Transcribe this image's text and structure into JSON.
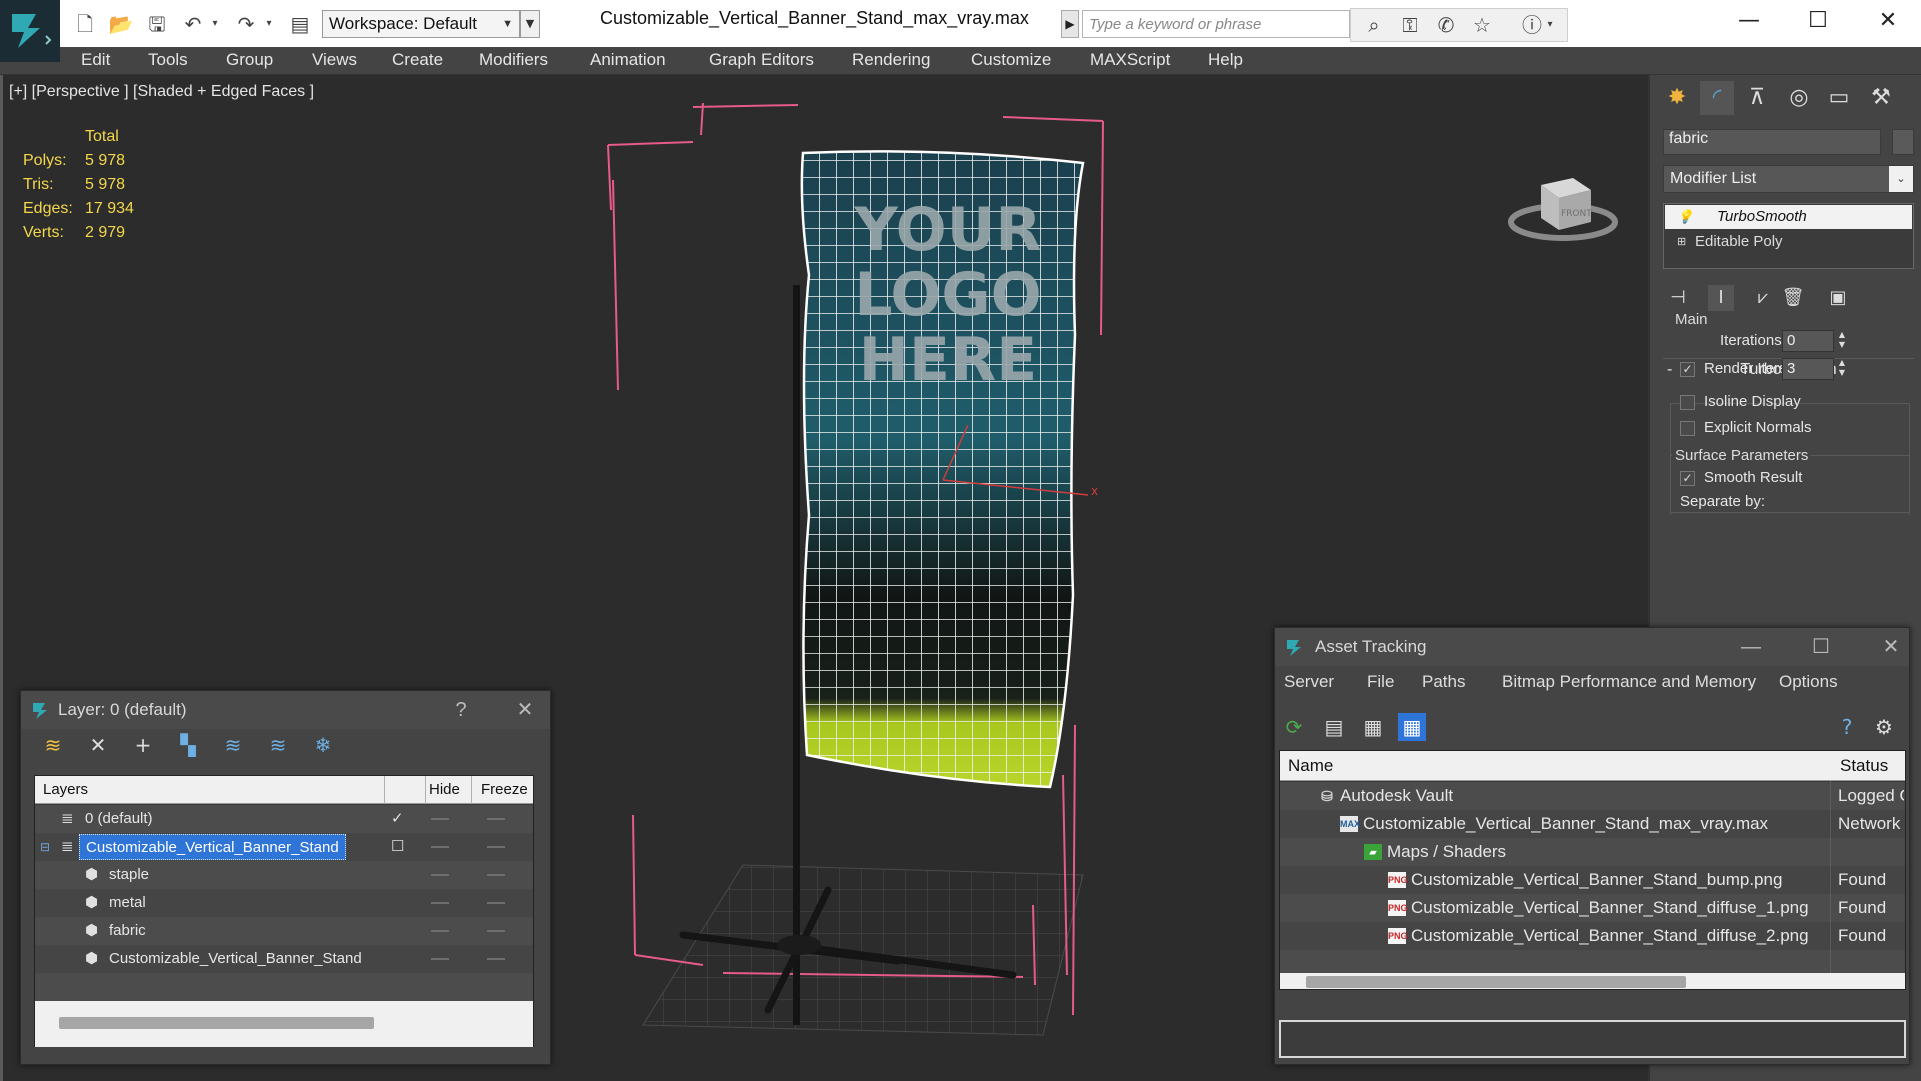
{
  "window": {
    "title": "Customizable_Vertical_Banner_Stand_max_vray.max",
    "workspace": "Workspace: Default",
    "search_placeholder": "Type a keyword or phrase",
    "minimize": "—",
    "maximize": "☐",
    "close": "✕"
  },
  "menu": [
    "Edit",
    "Tools",
    "Group",
    "Views",
    "Create",
    "Modifiers",
    "Animation",
    "Graph Editors",
    "Rendering",
    "Customize",
    "MAXScript",
    "Help"
  ],
  "viewport": {
    "label": "[+] [Perspective ] [Shaded + Edged Faces ]",
    "banner_text": [
      "YOUR",
      "LOGO",
      "HERE"
    ],
    "viewcube_label": "FRONT",
    "stats": {
      "header": "Total",
      "rows": [
        {
          "label": "Polys:",
          "value": "5 978"
        },
        {
          "label": "Tris:",
          "value": "5 978"
        },
        {
          "label": "Edges:",
          "value": "17 934"
        },
        {
          "label": "Verts:",
          "value": "2 979"
        }
      ]
    }
  },
  "command_panel": {
    "object_name": "fabric",
    "modifier_list": "Modifier List",
    "stack": [
      "TurboSmooth",
      "Editable Poly"
    ],
    "rollout": {
      "title": "TurboSmooth",
      "main_group": "Main",
      "iterations_label": "Iterations:",
      "iterations_value": "0",
      "render_iters_label": "Render Iters:",
      "render_iters_value": "3",
      "render_iters_checked": true,
      "isoline_label": "Isoline Display",
      "explicit_label": "Explicit Normals",
      "surface_group": "Surface Parameters",
      "smooth_result_label": "Smooth Result",
      "smooth_result_checked": true,
      "separate_by_label": "Separate by:"
    }
  },
  "layer_dialog": {
    "title": "Layer: 0 (default)",
    "help": "?",
    "columns": [
      "Layers",
      "Hide",
      "Freeze"
    ],
    "rows": [
      {
        "name": "0 (default)",
        "indent": 0,
        "active": true
      },
      {
        "name": "Customizable_Vertical_Banner_Stand",
        "indent": 0,
        "selected": true
      },
      {
        "name": "staple",
        "indent": 1
      },
      {
        "name": "metal",
        "indent": 1
      },
      {
        "name": "fabric",
        "indent": 1
      },
      {
        "name": "Customizable_Vertical_Banner_Stand",
        "indent": 1
      }
    ]
  },
  "asset_dialog": {
    "title": "Asset Tracking",
    "menu": [
      "Server",
      "File",
      "Paths",
      "Bitmap Performance and Memory",
      "Options"
    ],
    "columns": [
      "Name",
      "Status"
    ],
    "rows": [
      {
        "name": "Autodesk Vault",
        "status": "Logged Out",
        "indent": 0,
        "icon": "vault"
      },
      {
        "name": "Customizable_Vertical_Banner_Stand_max_vray.max",
        "status": "Network",
        "indent": 1,
        "icon": "max"
      },
      {
        "name": "Maps / Shaders",
        "status": "",
        "indent": 2,
        "icon": "maps"
      },
      {
        "name": "Customizable_Vertical_Banner_Stand_bump.png",
        "status": "Found",
        "indent": 3,
        "icon": "png"
      },
      {
        "name": "Customizable_Vertical_Banner_Stand_diffuse_1.png",
        "status": "Found",
        "indent": 3,
        "icon": "png"
      },
      {
        "name": "Customizable_Vertical_Banner_Stand_diffuse_2.png",
        "status": "Found",
        "indent": 3,
        "icon": "png"
      }
    ]
  },
  "colors": {
    "accent_blue": "#2f74d7",
    "stats_yellow": "#f4d74b",
    "bbox_pink": "#e65a8c",
    "banner_teal": "#1f5d6b",
    "banner_green": "#a9c81e"
  }
}
